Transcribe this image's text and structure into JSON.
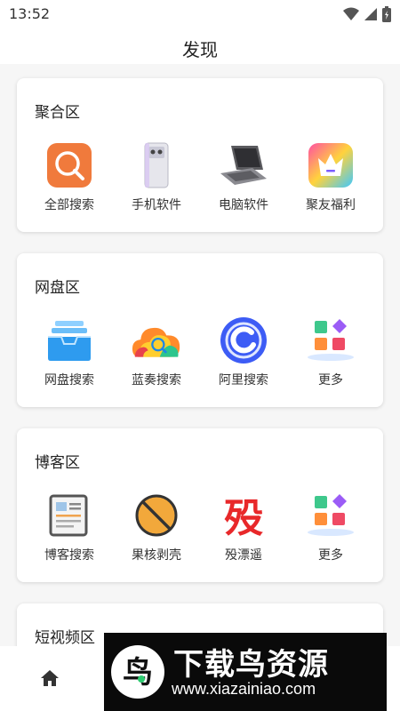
{
  "status_bar": {
    "time": "13:52",
    "icons": [
      "wifi-icon",
      "signal-icon",
      "battery-icon"
    ]
  },
  "header": {
    "title": "发现"
  },
  "sections": [
    {
      "title": "聚合区",
      "items": [
        {
          "label": "全部搜索",
          "icon": "search-app-icon"
        },
        {
          "label": "手机软件",
          "icon": "phone-icon"
        },
        {
          "label": "电脑软件",
          "icon": "laptop-icon"
        },
        {
          "label": "聚友福利",
          "icon": "crown-icon"
        }
      ]
    },
    {
      "title": "网盘区",
      "items": [
        {
          "label": "网盘搜索",
          "icon": "tray-icon"
        },
        {
          "label": "蓝奏搜索",
          "icon": "cloud-search-icon"
        },
        {
          "label": "阿里搜索",
          "icon": "aliyun-icon"
        },
        {
          "label": "更多",
          "icon": "more-blocks-icon"
        }
      ]
    },
    {
      "title": "博客区",
      "items": [
        {
          "label": "博客搜索",
          "icon": "newspaper-icon"
        },
        {
          "label": "果核剥壳",
          "icon": "nut-icon"
        },
        {
          "label": "殁漂遥",
          "icon": "mo-character-icon"
        },
        {
          "label": "更多",
          "icon": "more-blocks-icon"
        }
      ]
    },
    {
      "title": "短视频区",
      "items": []
    }
  ],
  "bottom_nav": {
    "home_icon": "home-icon"
  },
  "watermark": {
    "text": "下载鸟资源",
    "url": "www.xiazainiao.com",
    "logo_char": "鸟"
  },
  "colors": {
    "accent_orange": "#f07a3c",
    "brand_blue": "#3d7cf0",
    "red_text": "#e8282a"
  }
}
